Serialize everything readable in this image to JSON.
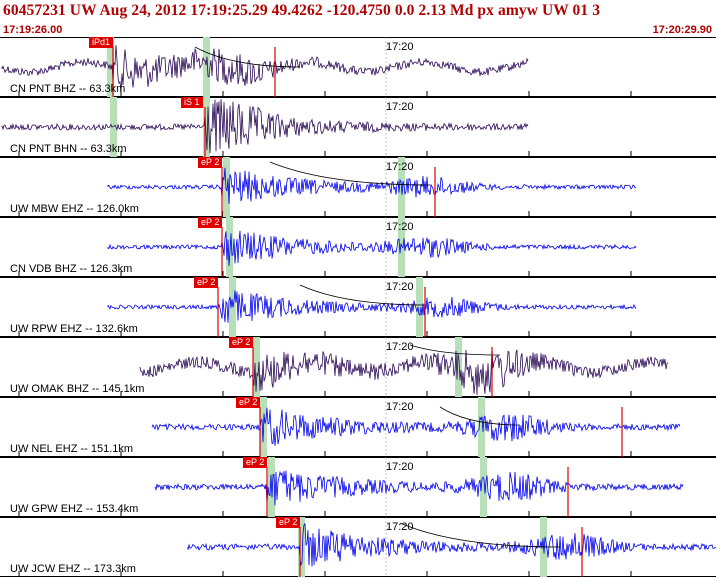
{
  "header": {
    "title": "60457231 UW Aug 24, 2012 17:19:25.29    49.4262 -120.4750  0.0 2.13 Md px amyw UW 01   3",
    "start_time": "17:19:26.00",
    "end_time": "17:20:29.90"
  },
  "colors": {
    "header_text": "#b00000",
    "trace_dark": "#2b0a57",
    "trace_blue": "#0000ee",
    "pick": "#e00000",
    "arrival_band": "#b8e0b8",
    "grid": "#000000"
  },
  "panels": [
    {
      "channel": "CN PNT BHZ -- 63.3km",
      "pick": "iPd1",
      "minute": "17:20",
      "trace": "dark"
    },
    {
      "channel": "CN PNT BHN -- 63.3km",
      "pick": "iS 1",
      "minute": "17:20",
      "trace": "dark"
    },
    {
      "channel": "UW MBW EHZ -- 126.0km",
      "pick": "eP 2",
      "minute": "17:20",
      "trace": "blue"
    },
    {
      "channel": "CN VDB BHZ -- 126.3km",
      "pick": "eP 2",
      "minute": "17:20",
      "trace": "blue"
    },
    {
      "channel": "UW RPW EHZ -- 132.6km",
      "pick": "eP 2",
      "minute": "17:20",
      "trace": "blue"
    },
    {
      "channel": "UW OMAK BHZ -- 145.1km",
      "pick": "eP 2",
      "minute": "17:20",
      "trace": "dark"
    },
    {
      "channel": "UW NEL EHZ -- 151.1km",
      "pick": "eP 2",
      "minute": "17:20",
      "trace": "blue"
    },
    {
      "channel": "UW GPW EHZ -- 153.4km",
      "pick": "eP 2",
      "minute": "17:20",
      "trace": "blue"
    },
    {
      "channel": "UW JCW EHZ -- 173.3km",
      "pick": "eP 2",
      "minute": "17:20",
      "trace": "blue"
    }
  ]
}
